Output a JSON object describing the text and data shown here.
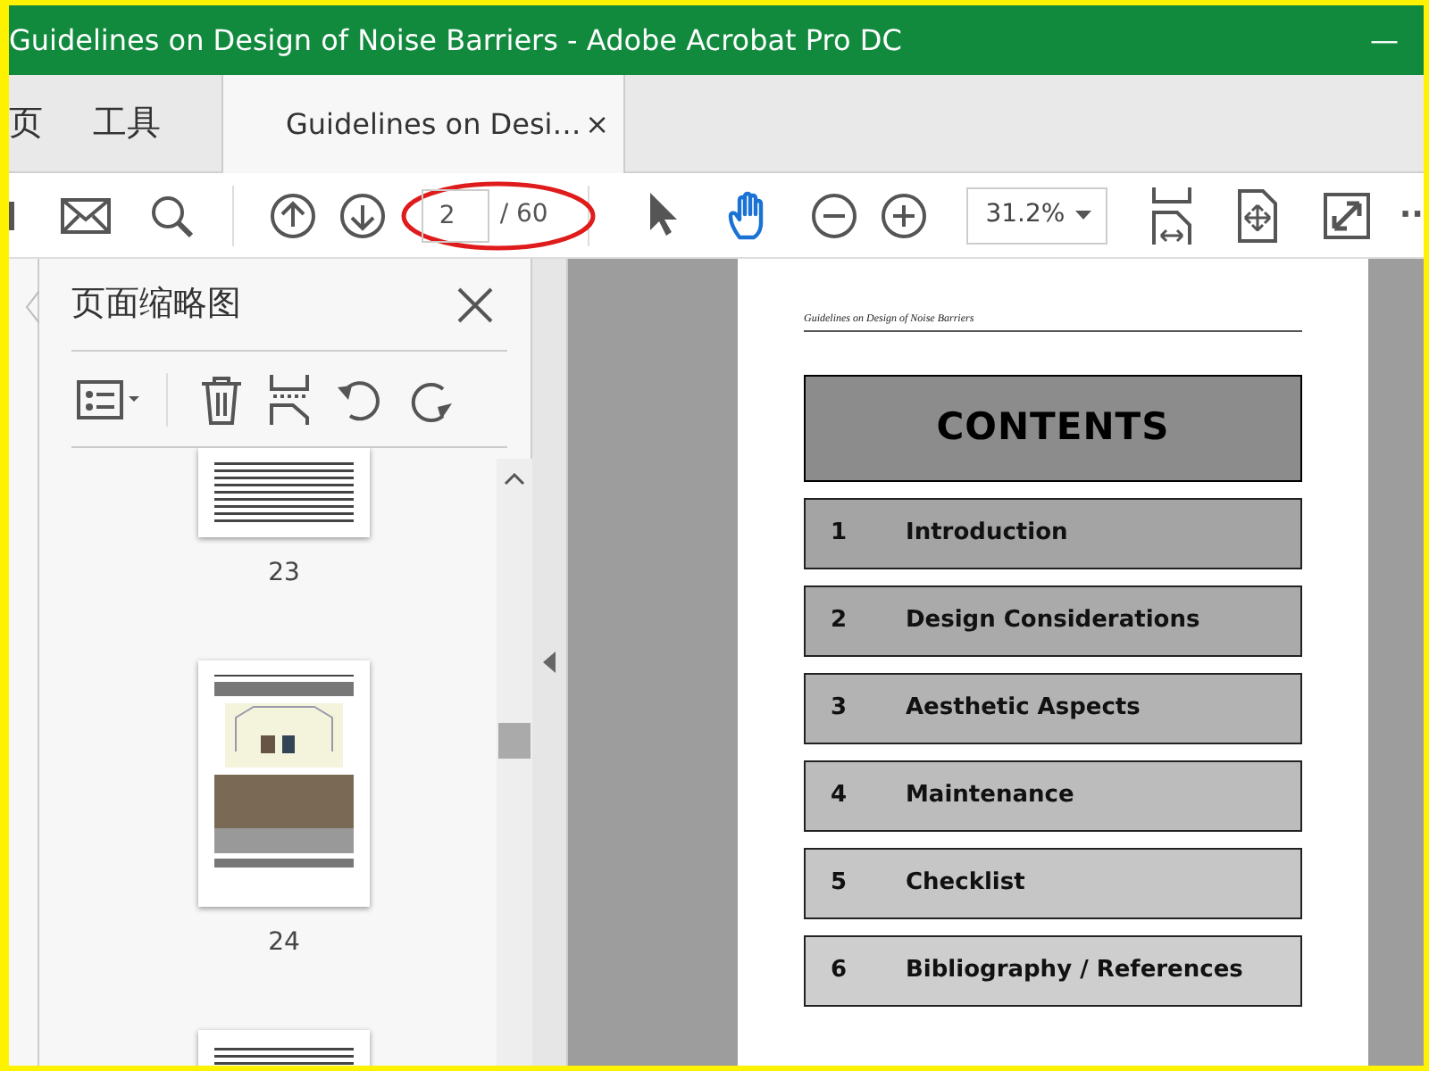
{
  "window": {
    "title": "Guidelines on Design of Noise Barriers - Adobe Acrobat Pro DC",
    "minimize": "—"
  },
  "nav_tabs": [
    {
      "label": "页",
      "selected": false
    },
    {
      "label": "工具",
      "selected": false
    }
  ],
  "document_tab": {
    "label": "Guidelines on Desi…",
    "close": "×",
    "selected": true
  },
  "toolbar": {
    "page_number": "2",
    "page_total": "/ 60",
    "zoom": "31.2%",
    "more": "··",
    "tools": [
      {
        "kind": "select",
        "selected": false
      },
      {
        "kind": "hand",
        "selected": true
      }
    ],
    "annotation": {
      "kind": "ellipse",
      "color": "#e01b1b"
    }
  },
  "sidebar": {
    "title": "页面缩略图",
    "thumbnails": [
      {
        "kind": "text",
        "label": "23"
      },
      {
        "kind": "figures",
        "label": "24"
      },
      {
        "kind": "text"
      }
    ]
  },
  "document": {
    "running_header": "Guidelines on Design of Noise Barriers",
    "heading": "CONTENTS",
    "entries": [
      {
        "number": "1",
        "title": "Introduction",
        "color": "#a4a4a4"
      },
      {
        "number": "2",
        "title": "Design Considerations",
        "color": "#aaaaaa"
      },
      {
        "number": "3",
        "title": "Aesthetic Aspects",
        "color": "#b3b3b3"
      },
      {
        "number": "4",
        "title": "Maintenance",
        "color": "#bcbcbc"
      },
      {
        "number": "5",
        "title": "Checklist",
        "color": "#c6c6c6"
      },
      {
        "number": "6",
        "title": "Bibliography / References",
        "color": "#cecece"
      }
    ]
  }
}
